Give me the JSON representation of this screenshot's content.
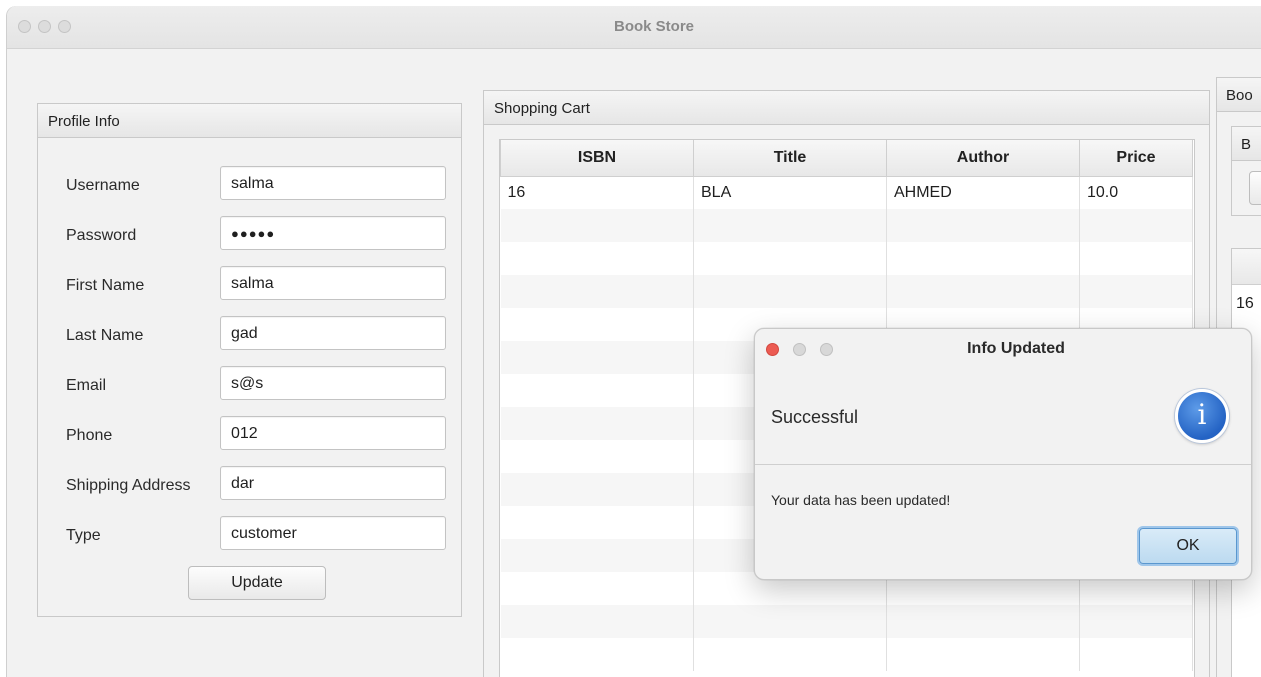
{
  "window": {
    "title": "Book Store"
  },
  "profile": {
    "title": "Profile Info",
    "fields": [
      {
        "label": "Username",
        "value": "salma"
      },
      {
        "label": "Password",
        "value": "●●●●●"
      },
      {
        "label": "First Name",
        "value": "salma"
      },
      {
        "label": "Last Name",
        "value": "gad"
      },
      {
        "label": "Email",
        "value": "s@s"
      },
      {
        "label": "Phone",
        "value": "012"
      },
      {
        "label": "Shipping Address",
        "value": "dar"
      },
      {
        "label": "Type",
        "value": "customer"
      }
    ],
    "update_label": "Update"
  },
  "cart": {
    "title": "Shopping Cart",
    "columns": [
      "ISBN",
      "Title",
      "Author",
      "Price"
    ],
    "rows": [
      [
        "16",
        "BLA",
        "AHMED",
        "10.0"
      ]
    ]
  },
  "right_panel": {
    "title_partial": "Boo",
    "sub_partial": "B",
    "row_partial": "16"
  },
  "dialog": {
    "title": "Info Updated",
    "header": "Successful",
    "message": "Your data has been updated!",
    "ok_label": "OK",
    "icon": "info-icon",
    "accent": "#2463c4"
  }
}
